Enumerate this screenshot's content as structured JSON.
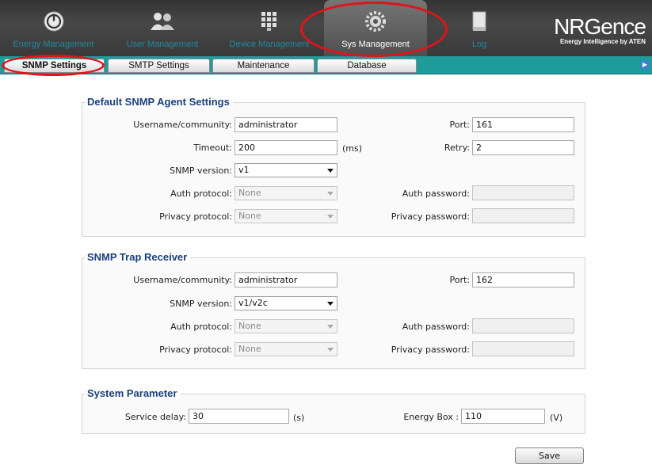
{
  "nav": {
    "items": [
      {
        "label": "Energy Management",
        "icon": "power-icon"
      },
      {
        "label": "User Management",
        "icon": "users-icon"
      },
      {
        "label": "Device Management",
        "icon": "device-grid-icon"
      },
      {
        "label": "Sys Management",
        "icon": "gear-icon"
      },
      {
        "label": "Log",
        "icon": "log-icon"
      }
    ],
    "brand_main": "NRGence",
    "brand_tagline": "Energy Intelligence by ATEN"
  },
  "subnav": {
    "tabs": [
      "SNMP Settings",
      "SMTP Settings",
      "Maintenance",
      "Database"
    ],
    "active": "SNMP Settings"
  },
  "agent": {
    "title": "Default SNMP Agent Settings",
    "username_label": "Username/community:",
    "username_value": "administrator",
    "port_label": "Port:",
    "port_value": "161",
    "timeout_label": "Timeout:",
    "timeout_value": "200",
    "timeout_unit": "(ms)",
    "retry_label": "Retry:",
    "retry_value": "2",
    "version_label": "SNMP version:",
    "version_value": "v1",
    "auth_protocol_label": "Auth protocol:",
    "auth_protocol_value": "None",
    "auth_password_label": "Auth password:",
    "privacy_protocol_label": "Privacy protocol:",
    "privacy_protocol_value": "None",
    "privacy_password_label": "Privacy password:"
  },
  "trap": {
    "title": "SNMP Trap Receiver",
    "username_label": "Username/community:",
    "username_value": "administrator",
    "port_label": "Port:",
    "port_value": "162",
    "version_label": "SNMP version:",
    "version_value": "v1/v2c",
    "auth_protocol_label": "Auth protocol:",
    "auth_protocol_value": "None",
    "auth_password_label": "Auth password:",
    "privacy_protocol_label": "Privacy protocol:",
    "privacy_protocol_value": "None",
    "privacy_password_label": "Privacy password:"
  },
  "system": {
    "title": "System Parameter",
    "service_delay_label": "Service delay:",
    "service_delay_value": "30",
    "service_delay_unit": "(s)",
    "energy_box_label": "Energy Box :",
    "energy_box_value": "110",
    "energy_box_unit": "(V)"
  },
  "actions": {
    "save_label": "Save"
  },
  "colors": {
    "accent_teal": "#1e9c9c",
    "title_blue": "#1a3f7a",
    "highlight_red": "#e0141a"
  }
}
